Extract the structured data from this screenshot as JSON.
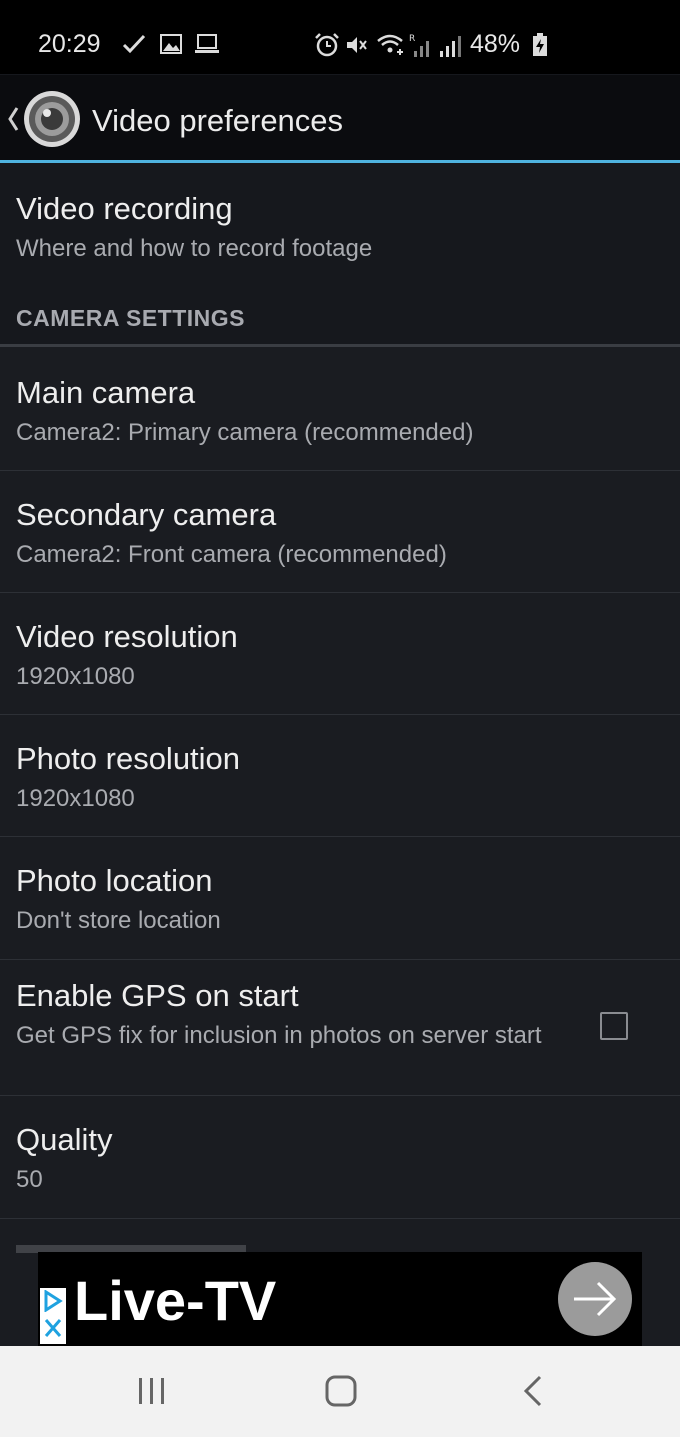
{
  "status_bar": {
    "time": "20:29",
    "battery": "48%",
    "icons": [
      "check-icon",
      "image-icon",
      "laptop-icon",
      "alarm-icon",
      "mute-icon",
      "wifi-icon",
      "signal-roaming-icon",
      "signal-icon",
      "battery-charging-icon"
    ]
  },
  "app_bar": {
    "title": "Video preferences",
    "back_icon": "chevron-left-icon",
    "app_icon": "camera-lens-icon"
  },
  "items": [
    {
      "title": "Video recording",
      "summary": "Where and how to record footage"
    }
  ],
  "section": {
    "label": "CAMERA SETTINGS"
  },
  "settings": [
    {
      "title": "Main camera",
      "summary": "Camera2: Primary camera (recommended)"
    },
    {
      "title": "Secondary camera",
      "summary": "Camera2: Front camera (recommended)"
    },
    {
      "title": "Video resolution",
      "summary": "1920x1080"
    },
    {
      "title": "Photo resolution",
      "summary": "1920x1080"
    },
    {
      "title": "Photo location",
      "summary": "Don't store location"
    },
    {
      "title": "Enable GPS on start",
      "summary": "Get GPS fix for inclusion in photos on server start",
      "checked": false
    },
    {
      "title": "Quality",
      "summary": "50"
    }
  ],
  "ad": {
    "text": "Live-TV",
    "icons": [
      "adchoices-icon",
      "close-icon",
      "arrow-right-icon"
    ]
  },
  "nav_bar": {
    "icons": [
      "recent-apps-icon",
      "home-icon",
      "back-icon"
    ]
  },
  "colors": {
    "accent": "#4fb3e0",
    "background": "#1a1c21",
    "app_bar": "#0b0c0f"
  }
}
